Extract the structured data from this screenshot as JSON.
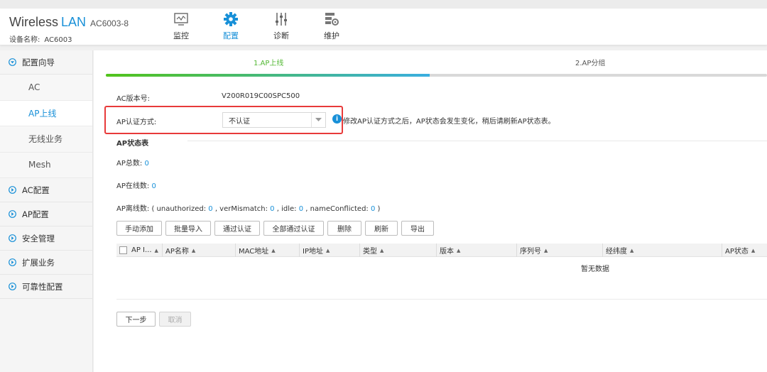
{
  "header": {
    "brand_main": "Wireless",
    "brand_accent": "LAN",
    "model": "AC6003-8",
    "device_label": "设备名称:",
    "device_value": "AC6003"
  },
  "nav": [
    {
      "label": "监控",
      "icon": "monitor-icon"
    },
    {
      "label": "配置",
      "icon": "gear-icon",
      "active": true
    },
    {
      "label": "诊断",
      "icon": "sliders-icon"
    },
    {
      "label": "维护",
      "icon": "maintenance-icon"
    }
  ],
  "sidebar": {
    "wizard": "配置向导",
    "sub_items": [
      "AC",
      "AP上线",
      "无线业务",
      "Mesh"
    ],
    "groups": [
      "AC配置",
      "AP配置",
      "安全管理",
      "扩展业务",
      "可靠性配置"
    ]
  },
  "steps": {
    "step1": "1.AP上线",
    "step2": "2.AP分组"
  },
  "progress_fraction": 0.49,
  "form": {
    "version_label": "AC版本号:",
    "version_value": "V200R019C00SPC500",
    "auth_label": "AP认证方式:",
    "auth_value": "不认证",
    "hint": "修改AP认证方式之后，AP状态会发生变化，稍后请刷新AP状态表。"
  },
  "status": {
    "title": "AP状态表",
    "total_label": "AP总数:",
    "total_value": "0",
    "online_label": "AP在线数:",
    "online_value": "0",
    "offline_label": "AP离线数:",
    "offline_prefix": "(",
    "unauth_label": "unauthorized:",
    "unauth_value": "0",
    "vermis_label": ", verMismatch:",
    "vermis_value": "0",
    "idle_label": ", idle:",
    "idle_value": "0",
    "namecon_label": ", nameConflicted:",
    "namecon_value": "0",
    "offline_suffix": ")"
  },
  "buttons": {
    "manual_add": "手动添加",
    "batch_import": "批量导入",
    "approve": "通过认证",
    "approve_all": "全部通过认证",
    "delete": "删除",
    "refresh": "刷新",
    "export": "导出"
  },
  "table": {
    "columns": [
      "AP I...",
      "AP名称",
      "MAC地址",
      "IP地址",
      "类型",
      "版本",
      "序列号",
      "经纬度",
      "AP状态"
    ],
    "empty_text": "暂无数据"
  },
  "footer": {
    "next": "下一步",
    "cancel": "取消"
  },
  "colors": {
    "accent": "#1890d8",
    "success": "#52b833",
    "highlight": "#e83a3a"
  }
}
